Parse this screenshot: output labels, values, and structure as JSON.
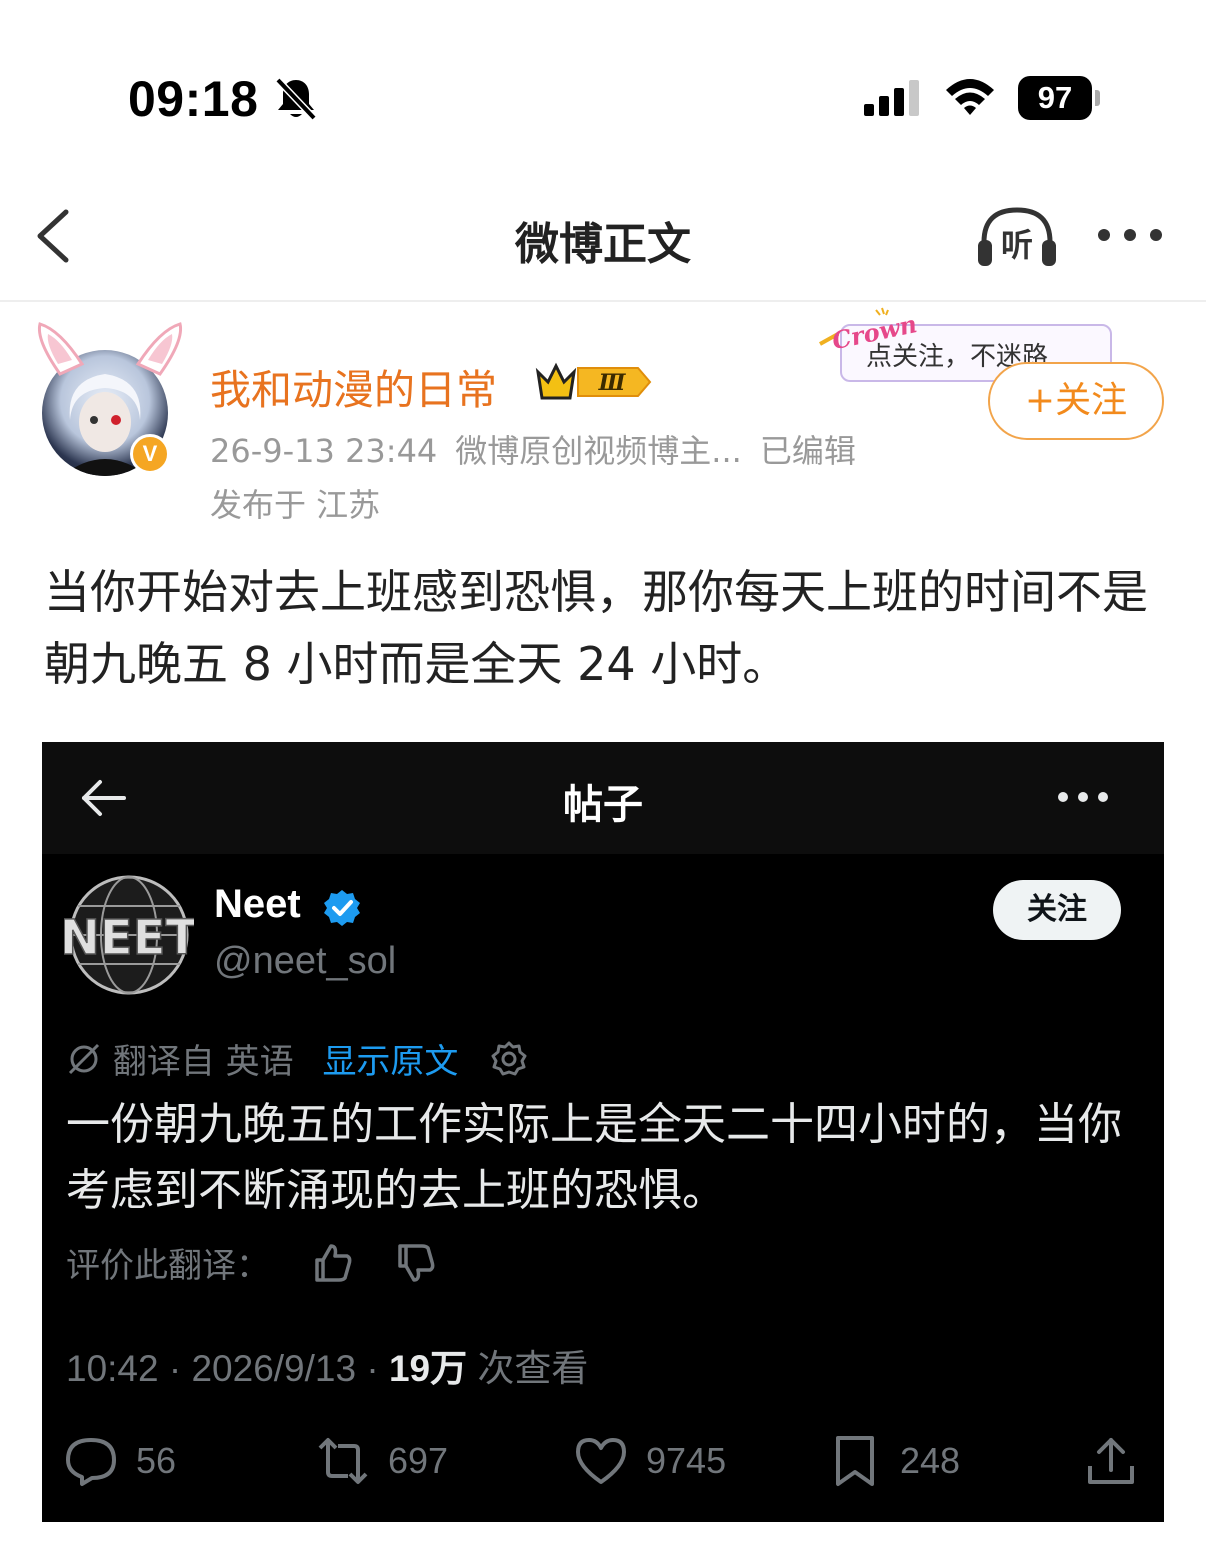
{
  "status_bar": {
    "time": "09:18",
    "battery_level": "97"
  },
  "nav": {
    "title": "微博正文",
    "listen_label": "听"
  },
  "author": {
    "name": "我和动漫的日常",
    "level_badge": "Ⅲ",
    "verified_mark": "V",
    "timestamp": "26-9-13 23:44",
    "source": "微博原创视频博主...",
    "edited": "已编辑",
    "location": "发布于 江苏",
    "follow_tip_deco": "Crown",
    "follow_tip": "点关注，不迷路",
    "follow_button": "+关注"
  },
  "post": {
    "text": "当你开始对去上班感到恐惧，那你每天上班的时间不是朝九晚五 8 小时而是全天 24 小时。"
  },
  "embedded_tweet": {
    "page_title": "帖子",
    "logo_text": "NEET",
    "display_name": "Neet",
    "handle": "@neet_sol",
    "follow_label": "关注",
    "translated_from": "翻译自 英语",
    "show_original": "显示原文",
    "text": "一份朝九晚五的工作实际上是全天二十四小时的，当你考虑到不断涌现的去上班的恐惧。",
    "rate_label": "评价此翻译：",
    "time_date": "10:42 · 2026/9/13 · ",
    "views_count": "19万",
    "views_label": " 次查看",
    "replies": "56",
    "reposts": "697",
    "likes": "9745",
    "bookmarks": "248"
  },
  "colors": {
    "author_name": "#e8731f",
    "follow_button": "#f28a1c",
    "link_blue": "#1d9bf0",
    "embed_bg": "#000000"
  }
}
